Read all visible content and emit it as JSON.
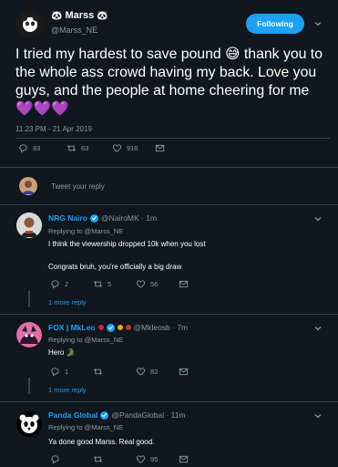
{
  "main_tweet": {
    "display_name": "Marss",
    "handle": "@Marss_NE",
    "follow_label": "Following",
    "text": "I tried my hardest to save pound 😅 thank you to the whole ass crowd having my back. Love you guys,  and the people at home cheering for me 💜💜💜",
    "timestamp": "11:23 PM - 21 Apr 2019",
    "replies": "83",
    "retweets": "63",
    "likes": "918"
  },
  "reply_box": {
    "placeholder": "Tweet your reply"
  },
  "replies": [
    {
      "name": "NRG Nairo",
      "handle_time": "@NairoMK · 1m",
      "replying_to": "Replying to @Marss_NE",
      "line1": "I think the viewership dropped 10k when you lost",
      "line2": "Congrats bruh, you're officially a big draw",
      "replies": "2",
      "retweets": "5",
      "likes": "56",
      "more": "1 more reply"
    },
    {
      "name": "FOX | MkLeo",
      "handle_time": "@Mkleosb · 7m",
      "replying_to": "Replying to @Marss_NE",
      "line1": "Hero 🐊",
      "replies": "1",
      "retweets": "",
      "likes": "82",
      "more": "1 more reply"
    },
    {
      "name": "Panda Global",
      "handle_time": "@PandaGlobal · 11m",
      "replying_to": "Replying to @Marss_NE",
      "line1": "Ya done good Marss. Real good.",
      "replies": "",
      "retweets": "",
      "likes": "95"
    }
  ],
  "colors": {
    "background": "#10171e",
    "accent": "#1da1f2",
    "muted": "#8899a6",
    "divider": "#38444d"
  }
}
